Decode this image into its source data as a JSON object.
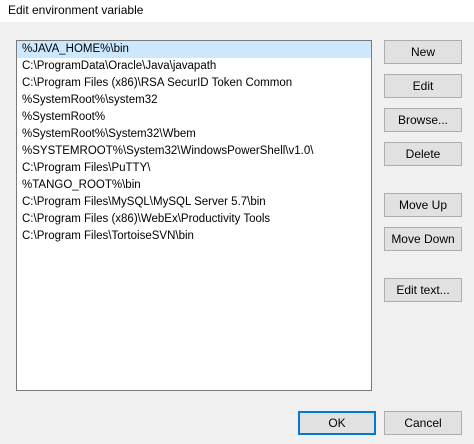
{
  "window": {
    "title": "Edit environment variable"
  },
  "paths": [
    "%JAVA_HOME%\\bin",
    "C:\\ProgramData\\Oracle\\Java\\javapath",
    "C:\\Program Files (x86)\\RSA SecurID Token Common",
    "%SystemRoot%\\system32",
    "%SystemRoot%",
    "%SystemRoot%\\System32\\Wbem",
    "%SYSTEMROOT%\\System32\\WindowsPowerShell\\v1.0\\",
    "C:\\Program Files\\PuTTY\\",
    "%TANGO_ROOT%\\bin",
    "C:\\Program Files\\MySQL\\MySQL Server 5.7\\bin",
    "C:\\Program Files (x86)\\WebEx\\Productivity Tools",
    "C:\\Program Files\\TortoiseSVN\\bin"
  ],
  "selected_index": 0,
  "buttons": {
    "new": "New",
    "edit": "Edit",
    "browse": "Browse...",
    "delete": "Delete",
    "move_up": "Move Up",
    "move_down": "Move Down",
    "edit_text": "Edit text...",
    "ok": "OK",
    "cancel": "Cancel"
  },
  "colors": {
    "selection": "#cce8ff",
    "default_button_border": "#0078d7"
  }
}
